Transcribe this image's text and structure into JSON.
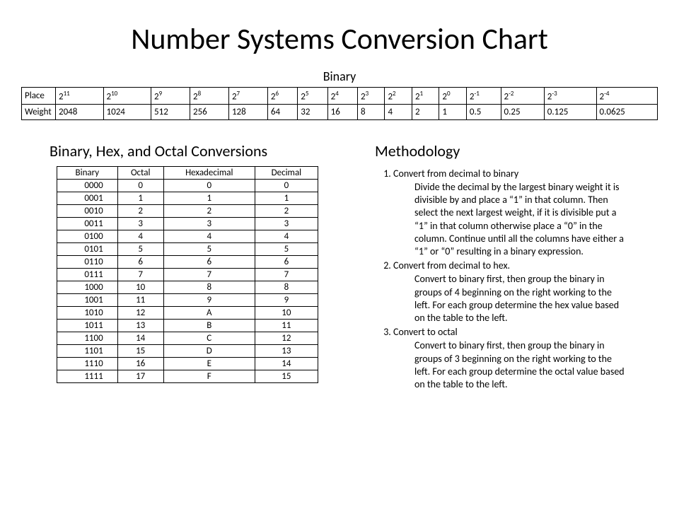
{
  "title": "Number Systems Conversion Chart",
  "binary_heading": "Binary",
  "weight_table": {
    "row_labels": [
      "Place",
      "Weight"
    ],
    "places": [
      {
        "base": "2",
        "exp": "11"
      },
      {
        "base": "2",
        "exp": "10"
      },
      {
        "base": "2",
        "exp": "9"
      },
      {
        "base": "2",
        "exp": "8"
      },
      {
        "base": "2",
        "exp": "7"
      },
      {
        "base": "2",
        "exp": "6"
      },
      {
        "base": "2",
        "exp": "5"
      },
      {
        "base": "2",
        "exp": "4"
      },
      {
        "base": "2",
        "exp": "3"
      },
      {
        "base": "2",
        "exp": "2"
      },
      {
        "base": "2",
        "exp": "1"
      },
      {
        "base": "2",
        "exp": "0"
      },
      {
        "base": "2",
        "exp": "-1"
      },
      {
        "base": "2",
        "exp": "-2"
      },
      {
        "base": "2",
        "exp": "-3"
      },
      {
        "base": "2",
        "exp": "-4"
      }
    ],
    "weights": [
      "2048",
      "1024",
      "512",
      "256",
      "128",
      "64",
      "32",
      "16",
      "8",
      "4",
      "2",
      "1",
      "0.5",
      "0.25",
      "0.125",
      "0.0625"
    ]
  },
  "conversions_heading": "Binary, Hex, and Octal Conversions",
  "conv_table": {
    "headers": [
      "Binary",
      "Octal",
      "Hexadecimal",
      "Decimal"
    ],
    "rows": [
      [
        "0000",
        "0",
        "0",
        "0"
      ],
      [
        "0001",
        "1",
        "1",
        "1"
      ],
      [
        "0010",
        "2",
        "2",
        "2"
      ],
      [
        "0011",
        "3",
        "3",
        "3"
      ],
      [
        "0100",
        "4",
        "4",
        "4"
      ],
      [
        "0101",
        "5",
        "5",
        "5"
      ],
      [
        "0110",
        "6",
        "6",
        "6"
      ],
      [
        "0111",
        "7",
        "7",
        "7"
      ],
      [
        "1000",
        "10",
        "8",
        "8"
      ],
      [
        "1001",
        "11",
        "9",
        "9"
      ],
      [
        "1010",
        "12",
        "A",
        "10"
      ],
      [
        "1011",
        "13",
        "B",
        "11"
      ],
      [
        "1100",
        "14",
        "C",
        "12"
      ],
      [
        "1101",
        "15",
        "D",
        "13"
      ],
      [
        "1110",
        "16",
        "E",
        "14"
      ],
      [
        "1111",
        "17",
        "F",
        "15"
      ]
    ]
  },
  "methodology": {
    "heading": "Methodology",
    "items": [
      {
        "title": "Convert from decimal to binary",
        "body": "Divide the decimal by the largest binary weight it is divisible by and place a “1” in that column. Then select the next largest weight, if it is divisible put a “1” in that column otherwise place a “0” in the column.  Continue until all the columns have either a “1” or “0” resulting in a binary expression."
      },
      {
        "title": "Convert from decimal to hex.",
        "body": "Convert to binary first, then group the binary in groups of 4 beginning on the right working to the left.  For each group determine the hex value based on the table to the left."
      },
      {
        "title": "Convert to octal",
        "body": "Convert to binary first, then group the binary in groups of 3 beginning on the right working to the left.  For each group determine the octal value based on the table to the left."
      }
    ]
  }
}
